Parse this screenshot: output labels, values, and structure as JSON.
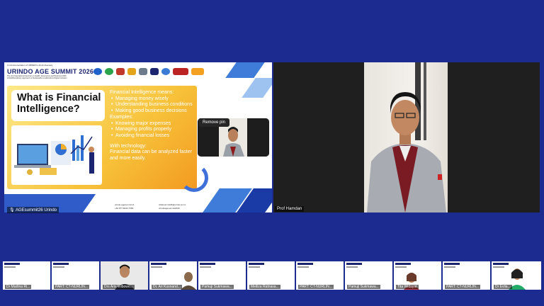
{
  "shared_screen": {
    "header_top": "In Commemoration of URINDO's 42 Anniversary",
    "summit_title": "URINDO AGE SUMMIT 2026",
    "summit_subtitle": "The 2nd International Seminar on Health, Economics and Business 2026",
    "summit_theme": "A Multidisciplinary Approach to Sustainable Livelihoods & Digital Inclusion",
    "slide_heading": "What is Financial Intelligence?",
    "bullet_intro": "Financial Intelligence means:",
    "bullets": [
      "Managing money wisely",
      "Understanding business conditions",
      "Making good business decisions"
    ],
    "examples_label": "Examples:",
    "examples": [
      "Knowing major expenses",
      "Managing profits properly",
      "Avoiding financial losses"
    ],
    "tech_label": "With technology:",
    "tech_text_1": "Financial data can be analyzed faster",
    "tech_text_2": "and more easily.",
    "footer_web": "urindo.agesummit.id",
    "footer_phone": "+62 877-8043-7384",
    "footer_email": "AGEsummit26@urindo.ac.id",
    "footer_social": "urindoagesummit2026",
    "remove_pin_label": "Remove pin",
    "presenter_name": "AGEsummit26 Urindo"
  },
  "main_speaker": {
    "name": "Prof Hamdan"
  },
  "participants": [
    {
      "label": "Dr Marlina Ri..."
    },
    {
      "label": "PART: CT-NURLIN..."
    },
    {
      "label": "Drs Aris Wibowo..."
    },
    {
      "label": "Dr. Ari Kusnand..."
    },
    {
      "label": "Pamuji Sukmawa..."
    },
    {
      "label": "Meiliza Ratnasa..."
    },
    {
      "label": "PART: CT-NURLIN..."
    },
    {
      "label": "Pamuji Sukmawa..."
    },
    {
      "label": "Tita Widayat"
    },
    {
      "label": "PART: CT-NURLIN..."
    },
    {
      "label": "Dr Evila..."
    }
  ],
  "colors": {
    "background": "#1b2b8f",
    "card_gold": "#f7c239",
    "title_navy": "#1b2570"
  }
}
